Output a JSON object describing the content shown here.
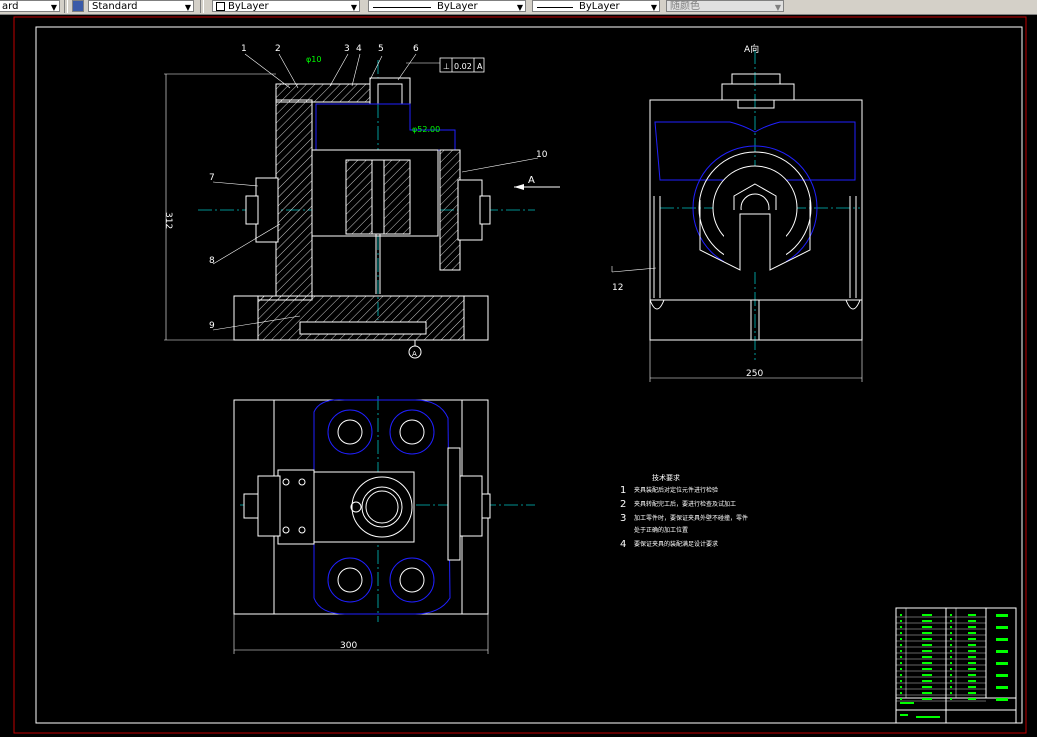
{
  "toolbar": {
    "text_style": "ard",
    "dim_style": "Standard",
    "layer": "ByLayer",
    "linetype": "ByLayer",
    "lineweight": "ByLayer",
    "plot_style": "随颜色"
  },
  "drawing": {
    "balloons": [
      "1",
      "2",
      "3",
      "4",
      "5",
      "6",
      "7",
      "8",
      "9",
      "10",
      "12"
    ],
    "tolerance_frame": [
      "⊥",
      "0.02",
      "A"
    ],
    "dim_diameter": "φ52.00",
    "dim_fit": "φ10",
    "dim_height": "312",
    "dim_width_top": "250",
    "dim_width_bottom": "300",
    "view_label": "A向",
    "arrow_label": "A",
    "datum_label": "A",
    "tech_req_title": "技术要求",
    "tech_req_numbers": [
      "1",
      "2",
      "3",
      "4"
    ],
    "tech_req_lines": [
      "夹具装配后对定位元件进行检验",
      "夹具转配完工后，要进行检查及试加工",
      "加工零件时，要保证夹具外壁不碰撞，零件",
      "处于正确的加工位置",
      "要保证夹具的装配满足设计要求"
    ]
  },
  "colors": {
    "background": "#000000",
    "lines": "#ffffff",
    "blue_layer": "#2020ff",
    "green_text": "#00ff00",
    "cyan_center": "#00c0c0",
    "frame_red": "#c00000"
  }
}
